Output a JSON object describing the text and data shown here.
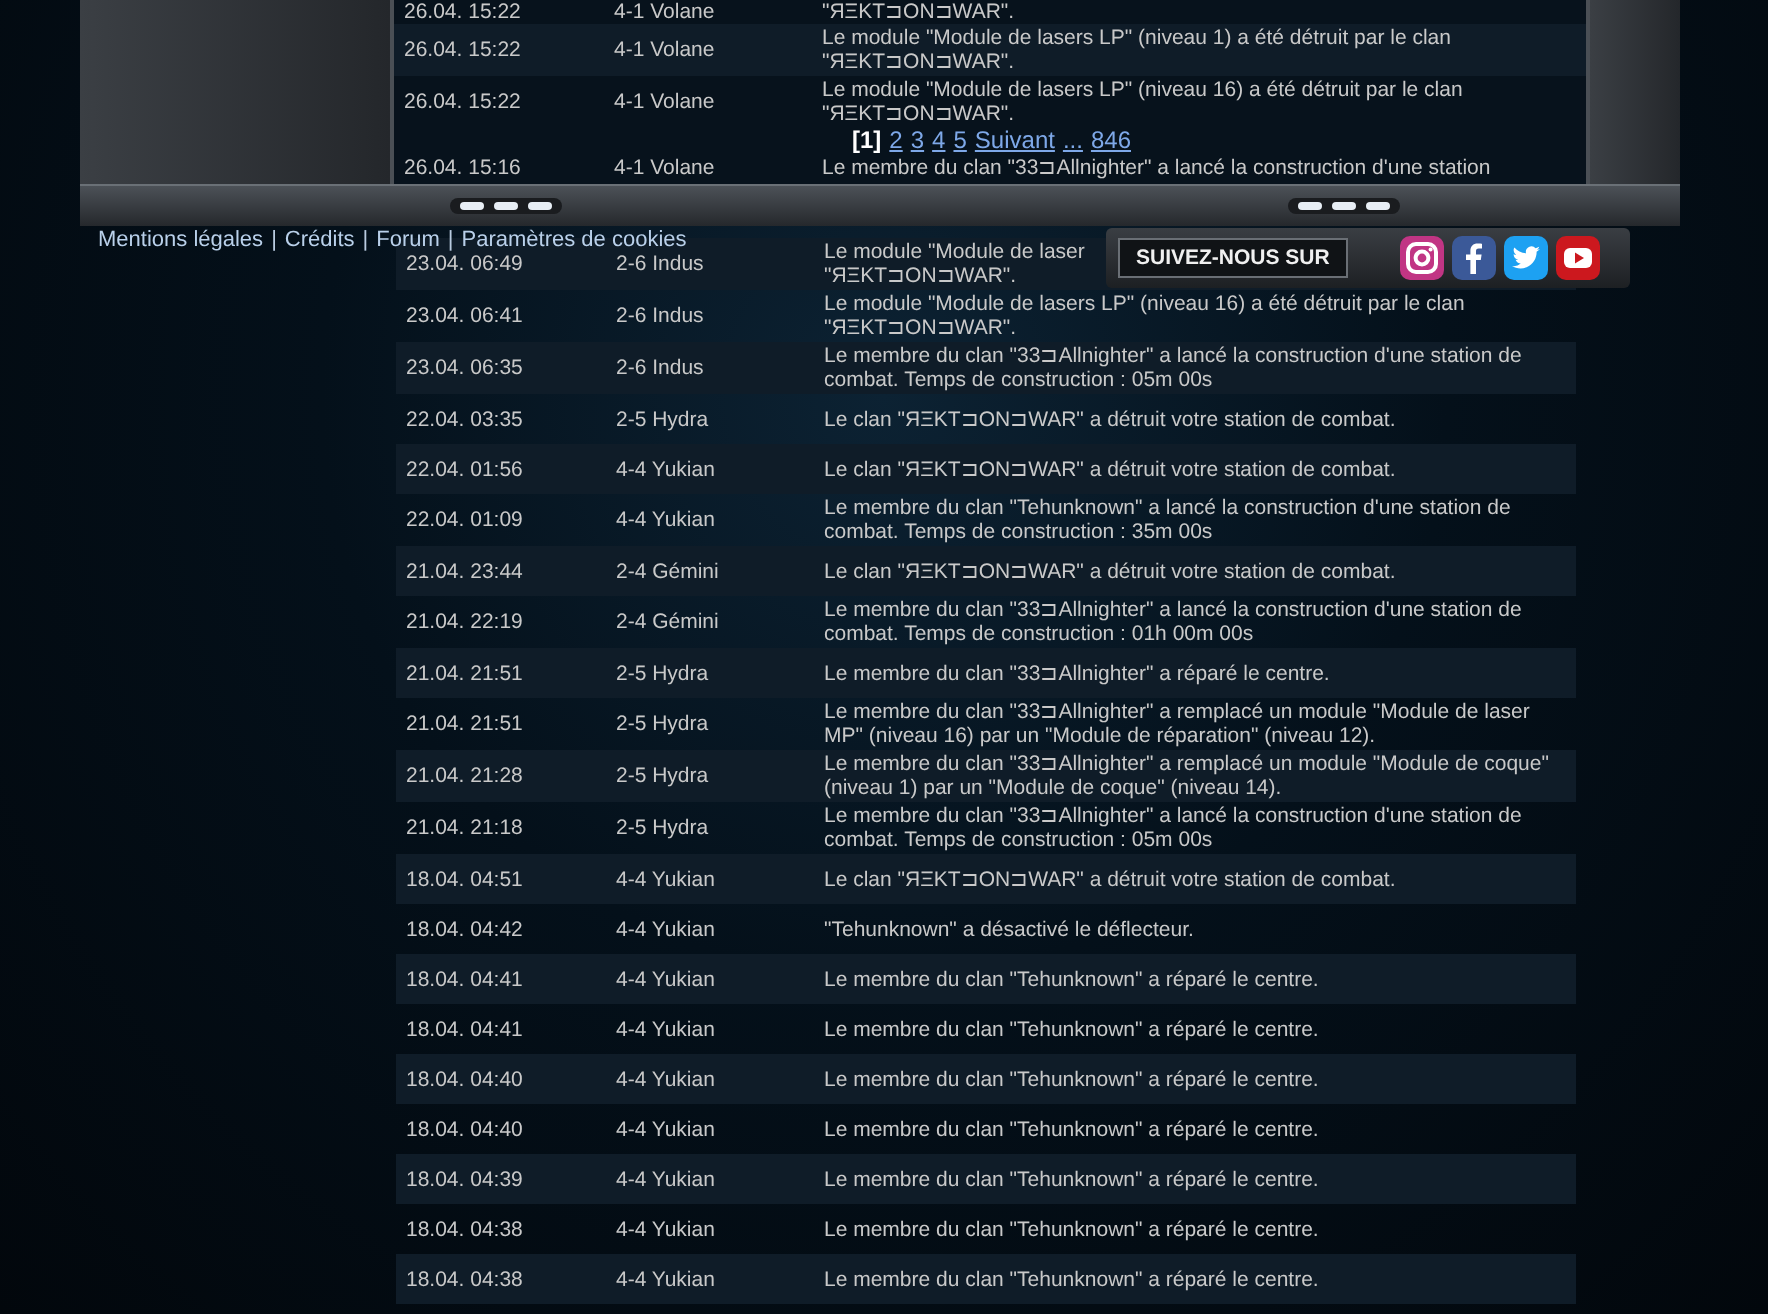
{
  "frame": {
    "rows": [
      {
        "date": "26.04. 15:22",
        "place": "4-1 Volane",
        "message": "\"ЯΞKT⊐ON⊐WAR\"."
      },
      {
        "date": "26.04. 15:22",
        "place": "4-1 Volane",
        "message": "Le module \"Module de lasers LP\" (niveau 1) a été détruit par le clan \"ЯΞKT⊐ON⊐WAR\"."
      },
      {
        "date": "26.04. 15:22",
        "place": "4-1 Volane",
        "message": "Le module \"Module de lasers LP\" (niveau 16) a été détruit par le clan \"ЯΞKT⊐ON⊐WAR\"."
      }
    ],
    "pagination": [
      {
        "label": "[1]",
        "selected": true
      },
      {
        "label": "2",
        "selected": false
      },
      {
        "label": "3",
        "selected": false
      },
      {
        "label": "4",
        "selected": false
      },
      {
        "label": "5",
        "selected": false
      },
      {
        "label": "Suivant",
        "selected": false
      },
      {
        "label": "...",
        "selected": false
      },
      {
        "label": "846",
        "selected": false
      }
    ],
    "last_row": {
      "date": "26.04. 15:16",
      "place": "4-1 Volane",
      "message": "Le membre du clan \"33⊐Allnighter\" a lancé la construction d'une station"
    }
  },
  "footer": {
    "separator": "|",
    "links": [
      "Mentions légales",
      "Crédits",
      "Forum",
      "Paramètres de cookies"
    ]
  },
  "social": {
    "label": "SUIVEZ-NOUS SUR",
    "icons": [
      {
        "kind": "instagram"
      },
      {
        "kind": "facebook"
      },
      {
        "kind": "twitter"
      },
      {
        "kind": "youtube"
      }
    ]
  },
  "log": {
    "rows": [
      {
        "date": "23.04. 06:49",
        "place": "2-6 Indus",
        "message": "Le module \"Module de laser\n\"ЯΞKT⊐ON⊐WAR\"."
      },
      {
        "date": "23.04. 06:41",
        "place": "2-6 Indus",
        "message": "Le module \"Module de lasers LP\" (niveau 16) a été détruit par le clan \"ЯΞKT⊐ON⊐WAR\"."
      },
      {
        "date": "23.04. 06:35",
        "place": "2-6 Indus",
        "message": "Le membre du clan \"33⊐Allnighter\" a lancé la construction d'une station de combat. Temps de construction : 05m 00s"
      },
      {
        "date": "22.04. 03:35",
        "place": "2-5 Hydra",
        "message": "Le clan \"ЯΞKT⊐ON⊐WAR\" a détruit votre station de combat."
      },
      {
        "date": "22.04. 01:56",
        "place": "4-4 Yukian",
        "message": "Le clan \"ЯΞKT⊐ON⊐WAR\" a détruit votre station de combat."
      },
      {
        "date": "22.04. 01:09",
        "place": "4-4 Yukian",
        "message": "Le membre du clan \"Tehunknown\" a lancé la construction d'une station de combat. Temps de construction : 35m 00s"
      },
      {
        "date": "21.04. 23:44",
        "place": "2-4 Gémini",
        "message": "Le clan \"ЯΞKT⊐ON⊐WAR\" a détruit votre station de combat."
      },
      {
        "date": "21.04. 22:19",
        "place": "2-4 Gémini",
        "message": "Le membre du clan \"33⊐Allnighter\" a lancé la construction d'une station de combat. Temps de construction : 01h 00m 00s"
      },
      {
        "date": "21.04. 21:51",
        "place": "2-5 Hydra",
        "message": "Le membre du clan \"33⊐Allnighter\" a réparé le centre."
      },
      {
        "date": "21.04. 21:51",
        "place": "2-5 Hydra",
        "message": "Le membre du clan \"33⊐Allnighter\" a remplacé un module \"Module de laser MP\" (niveau 16) par un \"Module de réparation\" (niveau 12)."
      },
      {
        "date": "21.04. 21:28",
        "place": "2-5 Hydra",
        "message": "Le membre du clan \"33⊐Allnighter\" a remplacé un module \"Module de coque\" (niveau 1) par un \"Module de coque\" (niveau 14)."
      },
      {
        "date": "21.04. 21:18",
        "place": "2-5 Hydra",
        "message": "Le membre du clan \"33⊐Allnighter\" a lancé la construction d'une station de combat. Temps de construction : 05m 00s"
      },
      {
        "date": "18.04. 04:51",
        "place": "4-4 Yukian",
        "message": "Le clan \"ЯΞKT⊐ON⊐WAR\" a détruit votre station de combat."
      },
      {
        "date": "18.04. 04:42",
        "place": "4-4 Yukian",
        "message": "\"Tehunknown\" a désactivé le déflecteur."
      },
      {
        "date": "18.04. 04:41",
        "place": "4-4 Yukian",
        "message": "Le membre du clan \"Tehunknown\" a réparé le centre."
      },
      {
        "date": "18.04. 04:41",
        "place": "4-4 Yukian",
        "message": "Le membre du clan \"Tehunknown\" a réparé le centre."
      },
      {
        "date": "18.04. 04:40",
        "place": "4-4 Yukian",
        "message": "Le membre du clan \"Tehunknown\" a réparé le centre."
      },
      {
        "date": "18.04. 04:40",
        "place": "4-4 Yukian",
        "message": "Le membre du clan \"Tehunknown\" a réparé le centre."
      },
      {
        "date": "18.04. 04:39",
        "place": "4-4 Yukian",
        "message": "Le membre du clan \"Tehunknown\" a réparé le centre."
      },
      {
        "date": "18.04. 04:38",
        "place": "4-4 Yukian",
        "message": "Le membre du clan \"Tehunknown\" a réparé le centre."
      },
      {
        "date": "18.04. 04:38",
        "place": "4-4 Yukian",
        "message": "Le membre du clan \"Tehunknown\" a réparé le centre."
      }
    ]
  }
}
